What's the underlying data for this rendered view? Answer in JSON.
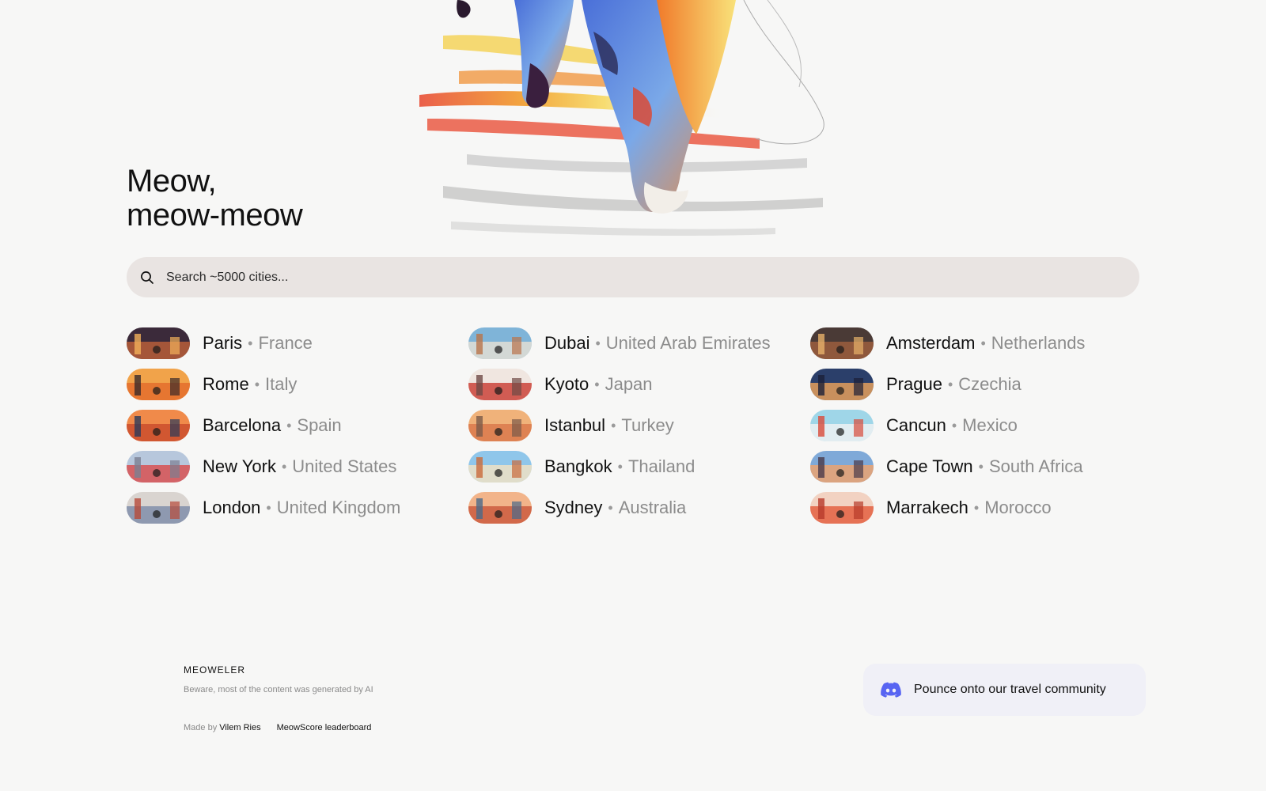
{
  "hero": {
    "headline_line1": "Meow,",
    "headline_line2": "meow-meow"
  },
  "search": {
    "placeholder": "Search ~5000 cities...",
    "value": ""
  },
  "cities": [
    {
      "name": "Paris",
      "country": "France",
      "separator": "•"
    },
    {
      "name": "Dubai",
      "country": "United Arab Emirates",
      "separator": "•"
    },
    {
      "name": "Amsterdam",
      "country": "Netherlands",
      "separator": "•"
    },
    {
      "name": "Rome",
      "country": "Italy",
      "separator": "•"
    },
    {
      "name": "Kyoto",
      "country": "Japan",
      "separator": "•"
    },
    {
      "name": "Prague",
      "country": "Czechia",
      "separator": "•"
    },
    {
      "name": "Barcelona",
      "country": "Spain",
      "separator": "•"
    },
    {
      "name": "Istanbul",
      "country": "Turkey",
      "separator": "•"
    },
    {
      "name": "Cancun",
      "country": "Mexico",
      "separator": "•"
    },
    {
      "name": "New York",
      "country": "United States",
      "separator": "•"
    },
    {
      "name": "Bangkok",
      "country": "Thailand",
      "separator": "•"
    },
    {
      "name": "Cape Town",
      "country": "South Africa",
      "separator": "•"
    },
    {
      "name": "London",
      "country": "United Kingdom",
      "separator": "•"
    },
    {
      "name": "Sydney",
      "country": "Australia",
      "separator": "•"
    },
    {
      "name": "Marrakech",
      "country": "Morocco",
      "separator": "•"
    }
  ],
  "footer": {
    "brand": "MEOWELER",
    "disclaimer": "Beware, most of the content was generated by AI",
    "made_by_prefix": "Made by",
    "author": "Vilem Ries",
    "leaderboard_link": "MeowScore leaderboard"
  },
  "community": {
    "label": "Pounce onto our travel community",
    "icon": "discord-icon",
    "icon_color": "#5865f2"
  },
  "colors": {
    "background": "#f7f7f6",
    "search_bg": "#e9e4e2",
    "community_bg": "#f0f0f7"
  }
}
